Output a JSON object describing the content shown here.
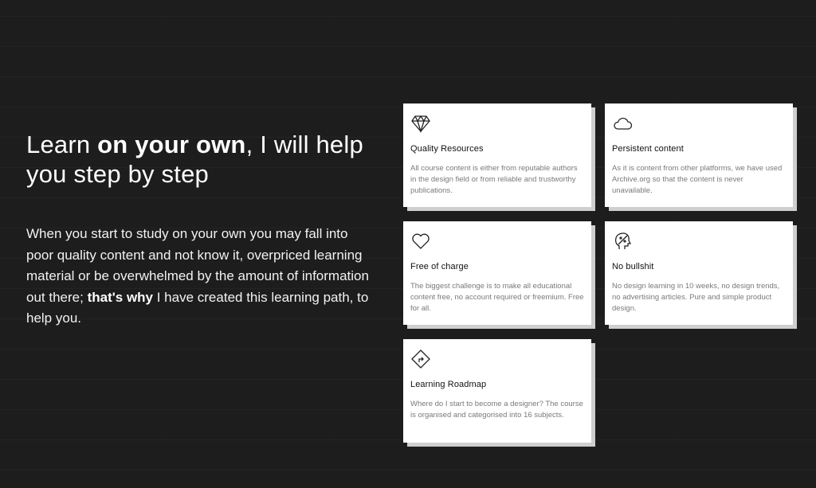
{
  "hero": {
    "heading_part1": "Learn ",
    "heading_bold": "on your own",
    "heading_part2": ", I will help you step by step",
    "body_part1": "When you start to study on your own you may fall into poor quality content and not know it, overpriced learning material or be overwhelmed by the amount of information out there; ",
    "body_bold": "that's why",
    "body_part2": " I have created this learning path, to help you."
  },
  "cards": [
    {
      "icon": "diamond-icon",
      "title": "Quality Resources",
      "description": "All course content is either from reputable authors in the design field or from reliable and trustworthy publications."
    },
    {
      "icon": "cloud-icon",
      "title": "Persistent content",
      "description": "As it is content from other platforms, we have used Archive.org so that the content is never unavailable."
    },
    {
      "icon": "heart-icon",
      "title": "Free of charge",
      "description": "The biggest challenge is to make all educational content free, no account required or freemium. Free for all."
    },
    {
      "icon": "no-bullshit-icon",
      "title": "No bullshit",
      "description": "No design learning in 10 weeks, no design trends, no advertising articles. Pure and simple product design."
    },
    {
      "icon": "roadmap-sign-icon",
      "title": "Learning Roadmap",
      "description": "Where do I start to become a designer?  The course is organised and categorised into 16 subjects."
    }
  ],
  "colors": {
    "background": "#1d1d1d",
    "card": "#ffffff",
    "card_shadow": "#cfcfcf",
    "description_text": "#7a7a7a"
  }
}
